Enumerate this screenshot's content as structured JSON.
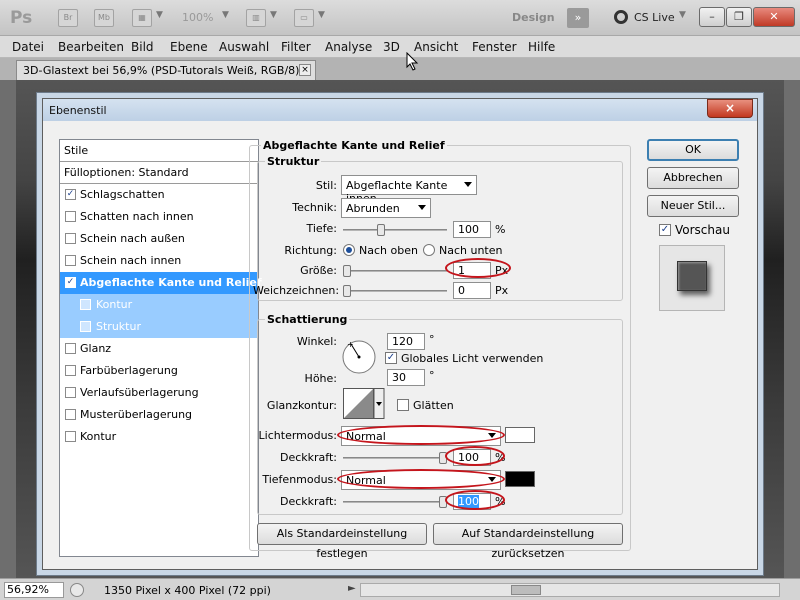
{
  "app": {
    "logo": "Ps",
    "bridge": "Br",
    "minibridge": "Mb",
    "zoom": "100%",
    "workspace": "Design",
    "more": "»",
    "cslive": "CS Live"
  },
  "menu": [
    "Datei",
    "Bearbeiten",
    "Bild",
    "Ebene",
    "Auswahl",
    "Filter",
    "Analyse",
    "3D",
    "Ansicht",
    "Fenster",
    "Hilfe"
  ],
  "document": {
    "tab_title": "3D-Glastext bei 56,9% (PSD-Tutorals Weiß, RGB/8) *",
    "close": "×"
  },
  "status": {
    "zoom": "56,92%",
    "doc_info": "1350 Pixel x 400 Pixel (72 ppi)",
    "arrow": "►"
  },
  "dialog": {
    "title": "Ebenenstil",
    "close": "×",
    "styles_header": "Stile",
    "blend_options": "Fülloptionen: Standard",
    "styles": [
      {
        "label": "Schlagschatten",
        "checked": "✓"
      },
      {
        "label": "Schatten nach innen",
        "checked": ""
      },
      {
        "label": "Schein nach außen",
        "checked": ""
      },
      {
        "label": "Schein nach innen",
        "checked": ""
      },
      {
        "label": "Abgeflachte Kante und Relief",
        "checked": "✓"
      },
      {
        "label": "Kontur",
        "checked": ""
      },
      {
        "label": "Struktur",
        "checked": ""
      },
      {
        "label": "Glanz",
        "checked": ""
      },
      {
        "label": "Farbüberlagerung",
        "checked": ""
      },
      {
        "label": "Verlaufsüberlagerung",
        "checked": ""
      },
      {
        "label": "Musterüberlagerung",
        "checked": ""
      },
      {
        "label": "Kontur",
        "checked": ""
      }
    ],
    "section_title": "Abgeflachte Kante und Relief",
    "structure": {
      "title": "Struktur",
      "style_label": "Stil:",
      "style_value": "Abgeflachte Kante innen",
      "technique_label": "Technik:",
      "technique_value": "Abrunden",
      "depth_label": "Tiefe:",
      "depth_value": "100",
      "depth_unit": "%",
      "direction_label": "Richtung:",
      "dir_up": "Nach oben",
      "dir_down": "Nach unten",
      "size_label": "Größe:",
      "size_value": "1",
      "size_unit": "Px",
      "soften_label": "Weichzeichnen:",
      "soften_value": "0",
      "soften_unit": "Px"
    },
    "shading": {
      "title": "Schattierung",
      "angle_label": "Winkel:",
      "angle_value": "120",
      "angle_unit": "°",
      "global_light": "Globales Licht verwenden",
      "global_checked": "✓",
      "altitude_label": "Höhe:",
      "altitude_value": "30",
      "altitude_unit": "°",
      "gloss_label": "Glanzkontur:",
      "antialias": "Glätten",
      "highlight_label": "Lichtermodus:",
      "highlight_mode": "Normal",
      "highlight_color": "#ffffff",
      "highlight_opacity_label": "Deckkraft:",
      "highlight_opacity": "100",
      "opacity_unit": "%",
      "shadow_label": "Tiefenmodus:",
      "shadow_mode": "Normal",
      "shadow_color": "#000000",
      "shadow_opacity_label": "Deckkraft:",
      "shadow_opacity": "100"
    },
    "btn_make_default": "Als Standardeinstellung festlegen",
    "btn_reset_default": "Auf Standardeinstellung zurücksetzen",
    "ok": "OK",
    "cancel": "Abbrechen",
    "new_style": "Neuer Stil...",
    "preview": "Vorschau",
    "preview_checked": "✓"
  },
  "colors": {
    "selection": "#3399ff",
    "annotation": "#c4151c"
  }
}
